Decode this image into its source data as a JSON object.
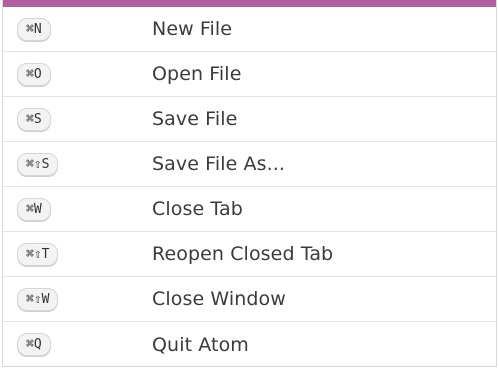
{
  "accent_color": "#b35ea1",
  "shortcuts": [
    {
      "keys": "⌘N",
      "action": "New File"
    },
    {
      "keys": "⌘O",
      "action": "Open File"
    },
    {
      "keys": "⌘S",
      "action": "Save File"
    },
    {
      "keys": "⌘⇧S",
      "action": "Save File As..."
    },
    {
      "keys": "⌘W",
      "action": "Close Tab"
    },
    {
      "keys": "⌘⇧T",
      "action": "Reopen Closed Tab"
    },
    {
      "keys": "⌘⇧W",
      "action": "Close Window"
    },
    {
      "keys": "⌘Q",
      "action": "Quit Atom"
    }
  ]
}
